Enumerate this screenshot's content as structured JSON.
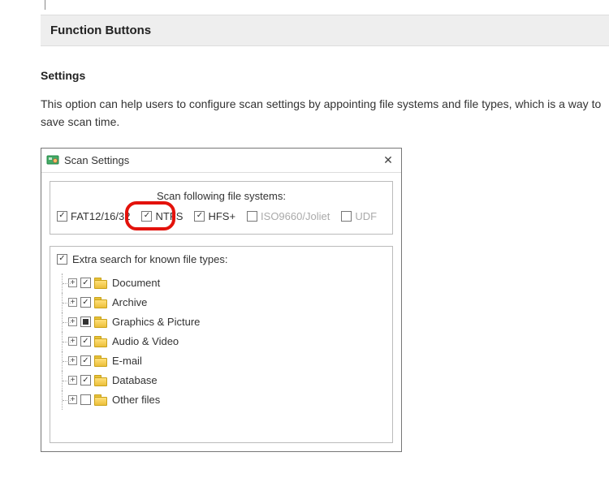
{
  "section_header": "Function Buttons",
  "sub_heading": "Settings",
  "description": "This option can help users to configure scan settings by appointing file systems and file types, which is a way to save scan time.",
  "dialog": {
    "title": "Scan Settings",
    "fs_title": "Scan following file systems:",
    "fs": [
      {
        "label": "FAT12/16/32",
        "state": "checked"
      },
      {
        "label": "NTFS",
        "state": "checked",
        "highlighted": true
      },
      {
        "label": "HFS+",
        "state": "checked"
      },
      {
        "label": "ISO9660/Joliet",
        "state": "unchecked",
        "disabled": true
      },
      {
        "label": "UDF",
        "state": "unchecked",
        "disabled": true
      }
    ],
    "extra_search_label": "Extra search for known file types:",
    "extra_search_state": "checked",
    "tree": [
      {
        "label": "Document",
        "state": "checked"
      },
      {
        "label": "Archive",
        "state": "checked"
      },
      {
        "label": "Graphics & Picture",
        "state": "indeterminate"
      },
      {
        "label": "Audio & Video",
        "state": "checked"
      },
      {
        "label": "E-mail",
        "state": "checked"
      },
      {
        "label": "Database",
        "state": "checked"
      },
      {
        "label": "Other files",
        "state": "unchecked"
      }
    ]
  }
}
